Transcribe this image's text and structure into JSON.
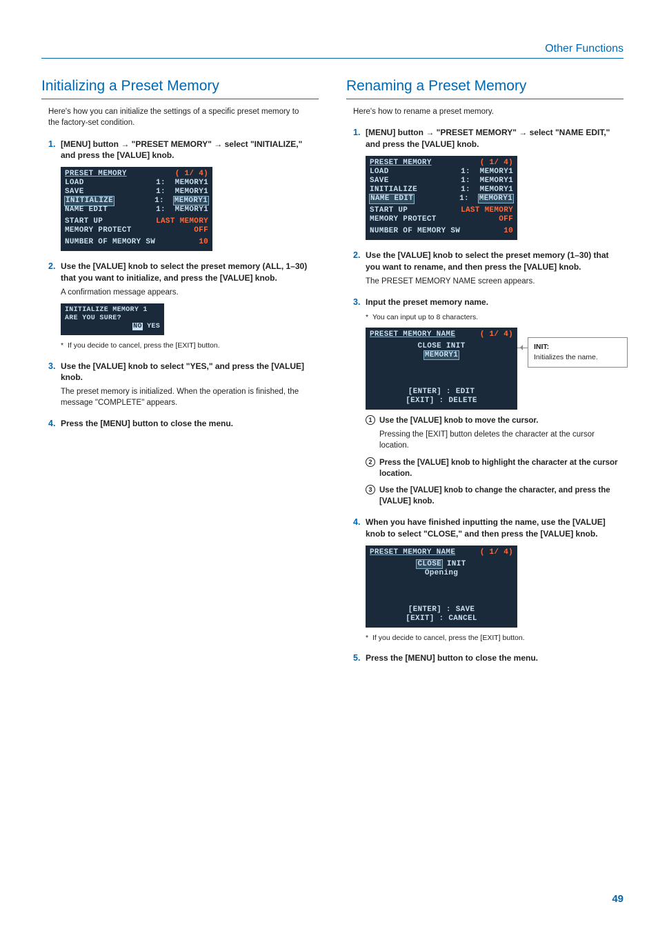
{
  "header": {
    "section": "Other Functions",
    "page_number": "49"
  },
  "left": {
    "title": "Initializing a Preset Memory",
    "intro": "Here's how you can initialize the settings of a specific preset memory to the factory-set condition.",
    "s1_a": "[MENU] button ",
    "s1_b": " \"PRESET MEMORY\" ",
    "s1_c": " select \"INITIALIZE,\" and press the [VALUE] knob.",
    "lcd1": {
      "title": "PRESET MEMORY",
      "page": "( 1/ 4)",
      "r1a": "LOAD",
      "r1b": "1:  MEMORY1",
      "r2a": "SAVE",
      "r2b": "1:  MEMORY1",
      "r3a": "INITIALIZE",
      "r3b": "1:  MEMORY1",
      "r4a": "NAME EDIT",
      "r4b": "1:  MEMORY1",
      "r5a": "START UP",
      "r5b": "LAST MEMORY",
      "r6a": "MEMORY PROTECT",
      "r6b": "OFF",
      "r7a": "NUMBER OF MEMORY SW",
      "r7b": "10"
    },
    "s2": "Use the [VALUE] knob to select the preset memory (ALL, 1–30) that you want to initialize, and press the [VALUE] knob.",
    "s2_body": "A confirmation message appears.",
    "lcd2": {
      "l1": "INITIALIZE MEMORY 1",
      "l2": "ARE YOU SURE?",
      "no": "NO",
      "yes": "YES"
    },
    "s2_note": "If you decide to cancel, press the [EXIT] button.",
    "s3": "Use the [VALUE] knob to select \"YES,\" and press the [VALUE] knob.",
    "s3_body": "The preset memory is initialized. When the operation is finished, the message \"COMPLETE\" appears.",
    "s4": "Press the [MENU] button to close the menu."
  },
  "right": {
    "title": "Renaming a Preset Memory",
    "intro": "Here's how to rename a preset memory.",
    "s1_a": "[MENU] button ",
    "s1_b": " \"PRESET MEMORY\" ",
    "s1_c": " select \"NAME EDIT,\" and press the [VALUE] knob.",
    "lcd1": {
      "title": "PRESET MEMORY",
      "page": "( 1/ 4)",
      "r1a": "LOAD",
      "r1b": "1:  MEMORY1",
      "r2a": "SAVE",
      "r2b": "1:  MEMORY1",
      "r3a": "INITIALIZE",
      "r3b": "1:  MEMORY1",
      "r4a": "NAME EDIT",
      "r4b": "1:  MEMORY1",
      "r5a": "START UP",
      "r5b": "LAST MEMORY",
      "r6a": "MEMORY PROTECT",
      "r6b": "OFF",
      "r7a": "NUMBER OF MEMORY SW",
      "r7b": "10"
    },
    "s2": "Use the [VALUE] knob to select the preset memory (1–30) that you want to rename, and then press the [VALUE] knob.",
    "s2_body": "The PRESET MEMORY NAME screen appears.",
    "s3": "Input the preset memory name.",
    "s3_note": "You can input up to 8 characters.",
    "lcd_name1": {
      "title": "PRESET MEMORY NAME",
      "page": "( 1/ 4)",
      "close": "CLOSE",
      "init": "INIT",
      "mem": "MEMORY1",
      "enter": "[ENTER] : EDIT",
      "exit": "[EXIT] : DELETE"
    },
    "callout": {
      "title": "INIT:",
      "body": "Initializes the name."
    },
    "sub1_head": "Use the [VALUE] knob to move the cursor.",
    "sub1_body": "Pressing the [EXIT] button deletes the character at the cursor location.",
    "sub2": "Press the [VALUE] knob to highlight the character at the cursor location.",
    "sub3": "Use the [VALUE] knob to change the character, and press the [VALUE] knob.",
    "s4": "When you have finished inputting the name, use the [VALUE] knob to select \"CLOSE,\" and then press the [VALUE] knob.",
    "lcd_name2": {
      "title": "PRESET MEMORY NAME",
      "page": "( 1/ 4)",
      "close": "CLOSE",
      "init": "INIT",
      "mem": "Opening",
      "enter": "[ENTER] : SAVE",
      "exit": "[EXIT] : CANCEL"
    },
    "s4_note": "If you decide to cancel, press the [EXIT] button.",
    "s5": "Press the [MENU] button to close the menu."
  }
}
